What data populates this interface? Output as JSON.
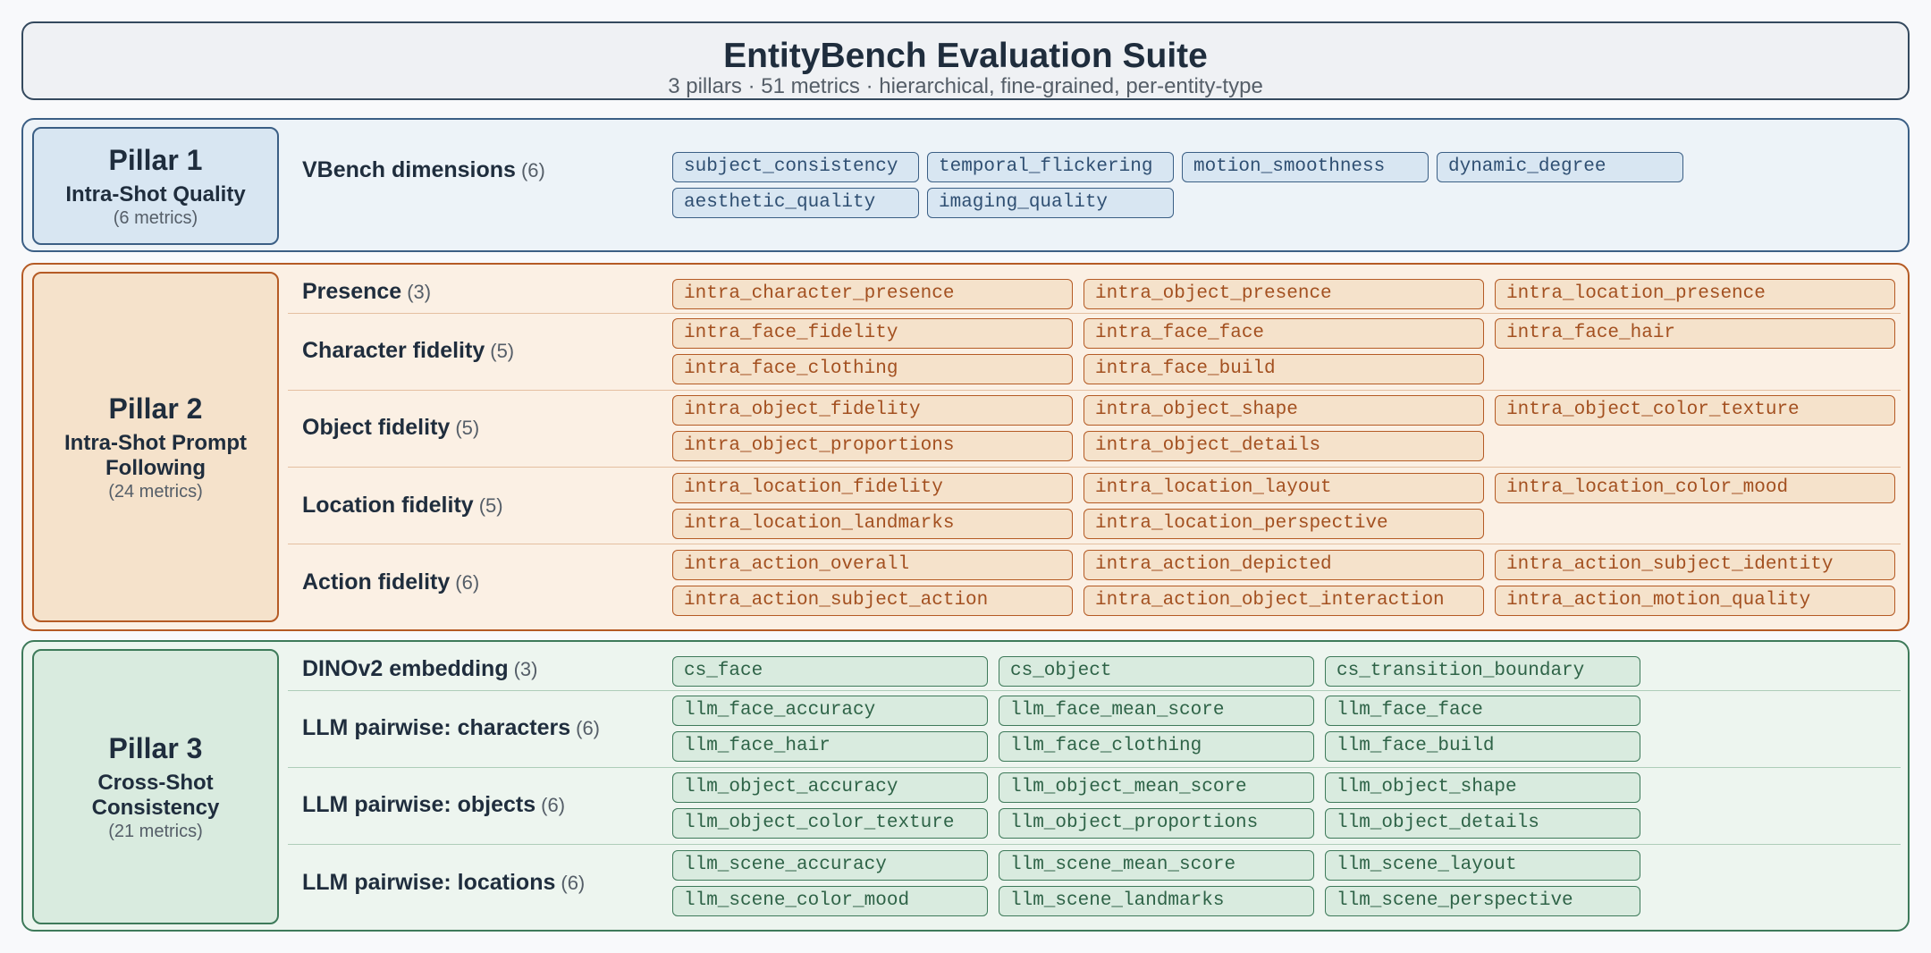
{
  "header": {
    "title": "EntityBench Evaluation Suite",
    "subtitle": "3 pillars  ·  51 metrics  ·  hierarchical, fine-grained, per-entity-type"
  },
  "pillars": [
    {
      "name": "Pillar 1",
      "description": "Intra-Shot Quality",
      "count": "(6 metrics)",
      "groups": [
        {
          "label": "VBench dimensions",
          "count": "(6)",
          "metrics": [
            "subject_consistency",
            "temporal_flickering",
            "motion_smoothness",
            "dynamic_degree",
            "aesthetic_quality",
            "imaging_quality"
          ]
        }
      ]
    },
    {
      "name": "Pillar 2",
      "description": "Intra-Shot Prompt Following",
      "count": "(24 metrics)",
      "groups": [
        {
          "label": "Presence",
          "count": "(3)",
          "metrics": [
            "intra_character_presence",
            "intra_object_presence",
            "intra_location_presence"
          ]
        },
        {
          "label": "Character fidelity",
          "count": "(5)",
          "metrics": [
            "intra_face_fidelity",
            "intra_face_face",
            "intra_face_hair",
            "intra_face_clothing",
            "intra_face_build"
          ]
        },
        {
          "label": "Object fidelity",
          "count": "(5)",
          "metrics": [
            "intra_object_fidelity",
            "intra_object_shape",
            "intra_object_color_texture",
            "intra_object_proportions",
            "intra_object_details"
          ]
        },
        {
          "label": "Location fidelity",
          "count": "(5)",
          "metrics": [
            "intra_location_fidelity",
            "intra_location_layout",
            "intra_location_color_mood",
            "intra_location_landmarks",
            "intra_location_perspective"
          ]
        },
        {
          "label": "Action fidelity",
          "count": "(6)",
          "metrics": [
            "intra_action_overall",
            "intra_action_depicted",
            "intra_action_subject_identity",
            "intra_action_subject_action",
            "intra_action_object_interaction",
            "intra_action_motion_quality"
          ]
        }
      ]
    },
    {
      "name": "Pillar 3",
      "description": "Cross-Shot Consistency",
      "count": "(21 metrics)",
      "groups": [
        {
          "label": "DINOv2 embedding",
          "count": "(3)",
          "metrics": [
            "cs_face",
            "cs_object",
            "cs_transition_boundary"
          ]
        },
        {
          "label": "LLM pairwise: characters",
          "count": "(6)",
          "metrics": [
            "llm_face_accuracy",
            "llm_face_mean_score",
            "llm_face_face",
            "llm_face_hair",
            "llm_face_clothing",
            "llm_face_build"
          ]
        },
        {
          "label": "LLM pairwise: objects",
          "count": "(6)",
          "metrics": [
            "llm_object_accuracy",
            "llm_object_mean_score",
            "llm_object_shape",
            "llm_object_color_texture",
            "llm_object_proportions",
            "llm_object_details"
          ]
        },
        {
          "label": "LLM pairwise: locations",
          "count": "(6)",
          "metrics": [
            "llm_scene_accuracy",
            "llm_scene_mean_score",
            "llm_scene_layout",
            "llm_scene_color_mood",
            "llm_scene_landmarks",
            "llm_scene_perspective"
          ]
        }
      ]
    }
  ]
}
